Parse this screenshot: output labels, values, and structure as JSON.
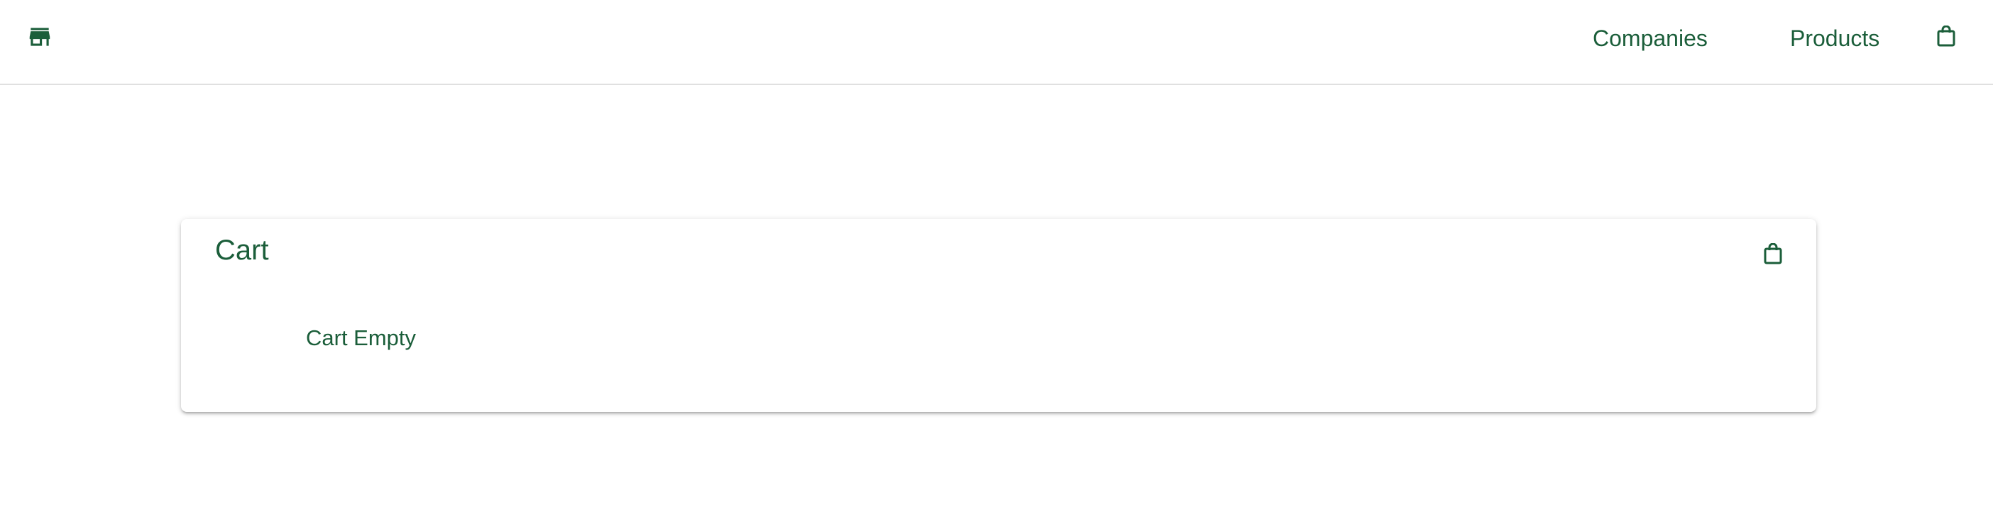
{
  "header": {
    "logo_icon": "storefront-icon",
    "nav": {
      "companies_label": "Companies",
      "products_label": "Products",
      "cart_icon": "shopping-bag-icon"
    }
  },
  "cart": {
    "title": "Cart",
    "icon": "shopping-bag-icon",
    "empty_message": "Cart Empty"
  },
  "colors": {
    "accent": "#1b5e3a",
    "divider": "#e0e0e0",
    "background": "#ffffff"
  }
}
